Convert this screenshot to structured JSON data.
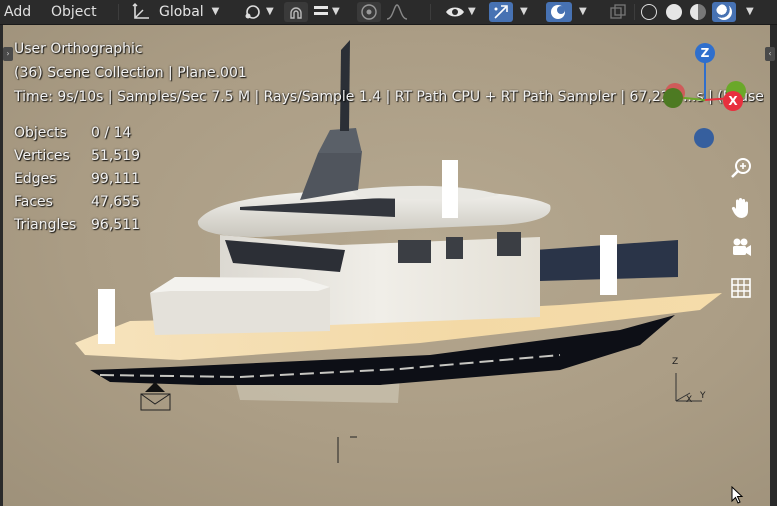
{
  "header": {
    "menus": [
      "Add",
      "Object"
    ],
    "transform_orientation": "Global",
    "icons": {
      "orientation": "transform-orientation-icon",
      "pivot": "pivot-point-icon",
      "snap": "snap-magnet-icon",
      "snap_increment": "snap-increment-icon",
      "proportional": "proportional-editing-icon",
      "falloff": "falloff-curve-icon",
      "visibility": "eye-visibility-icon",
      "gizmo": "gizmo-arrow-icon",
      "overlays": "overlays-icon",
      "xray": "xray-icon",
      "wireframe": "wireframe-shading-icon",
      "solid": "solid-shading-icon",
      "material": "material-preview-icon",
      "rendered": "rendered-shading-icon"
    }
  },
  "viewport": {
    "view_name": "User Orthographic",
    "collection": "(36) Scene Collection | Plane.001",
    "render_status": "Time: 9s/10s | Samples/Sec 7.5 M | Rays/Sample 1.4 | RT Path CPU + RT Path Sampler | 67,227 ...s | (Paused, ...",
    "stats": [
      {
        "label": "Objects",
        "value": "0 / 14"
      },
      {
        "label": "Vertices",
        "value": "51,519"
      },
      {
        "label": "Edges",
        "value": "99,111"
      },
      {
        "label": "Faces",
        "value": "47,655"
      },
      {
        "label": "Triangles",
        "value": "96,511"
      }
    ],
    "gizmo": {
      "z": "Z",
      "x": "X"
    },
    "nav_icons": [
      "zoom-icon",
      "hand-pan-icon",
      "camera-icon",
      "grid-ortho-icon"
    ],
    "corner_axes": {
      "z": "Z",
      "x": "X",
      "y": "Y"
    }
  },
  "colors": {
    "header_bg": "#2b2b2b",
    "active_button": "#4772b3",
    "axis_x": "#e8303e",
    "axis_y": "#6aa829",
    "axis_z": "#2f6fcd"
  }
}
